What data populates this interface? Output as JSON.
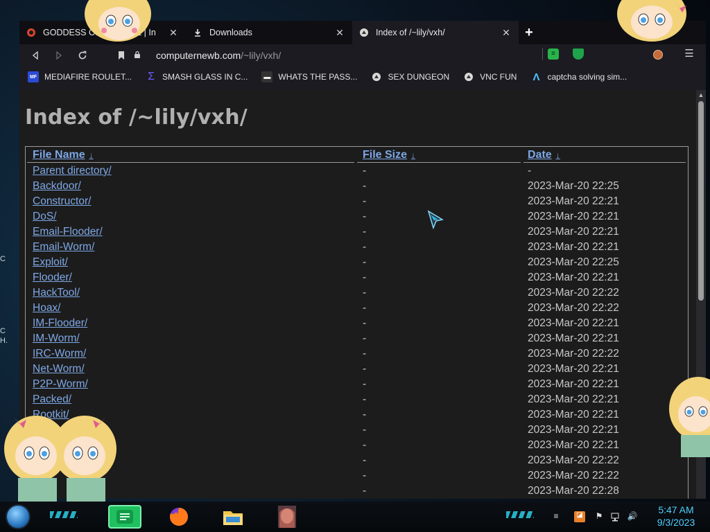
{
  "desktop": {
    "left_fragments": [
      "C",
      "C",
      "H."
    ]
  },
  "browser": {
    "tabs": [
      {
        "label": "GODDESS OF TWINKLE | In",
        "icon": "globe-icon",
        "active": false
      },
      {
        "label": "Downloads",
        "icon": "download-icon",
        "active": false
      },
      {
        "label": "Index of /~lily/vxh/",
        "icon": "site-icon",
        "active": true
      }
    ],
    "url": {
      "host": "computernewb.com",
      "path": "/~lily/vxh/"
    },
    "bookmarks": [
      {
        "label": "MEDIAFIRE ROULET...",
        "icon": "mediafire-icon"
      },
      {
        "label": "SMASH GLASS IN C...",
        "icon": "sigma-icon"
      },
      {
        "label": "WHATS THE PASS...",
        "icon": "dark-site-icon"
      },
      {
        "label": "SEX DUNGEON",
        "icon": "site-icon"
      },
      {
        "label": "VNC FUN",
        "icon": "site-icon"
      },
      {
        "label": "captcha solving sim...",
        "icon": "lambda-icon"
      }
    ]
  },
  "page": {
    "title": "Index of /~lily/vxh/",
    "columns": {
      "name": "File Name",
      "size": "File Size",
      "date": "Date",
      "sort_arrow": "↓"
    },
    "rows": [
      {
        "name": "Parent directory/",
        "size": "-",
        "date": "-"
      },
      {
        "name": "Backdoor/",
        "size": "-",
        "date": "2023-Mar-20 22:25"
      },
      {
        "name": "Constructor/",
        "size": "-",
        "date": "2023-Mar-20 22:21"
      },
      {
        "name": "DoS/",
        "size": "-",
        "date": "2023-Mar-20 22:21"
      },
      {
        "name": "Email-Flooder/",
        "size": "-",
        "date": "2023-Mar-20 22:21"
      },
      {
        "name": "Email-Worm/",
        "size": "-",
        "date": "2023-Mar-20 22:21"
      },
      {
        "name": "Exploit/",
        "size": "-",
        "date": "2023-Mar-20 22:25"
      },
      {
        "name": "Flooder/",
        "size": "-",
        "date": "2023-Mar-20 22:21"
      },
      {
        "name": "HackTool/",
        "size": "-",
        "date": "2023-Mar-20 22:22"
      },
      {
        "name": "Hoax/",
        "size": "-",
        "date": "2023-Mar-20 22:22"
      },
      {
        "name": "IM-Flooder/",
        "size": "-",
        "date": "2023-Mar-20 22:21"
      },
      {
        "name": "IM-Worm/",
        "size": "-",
        "date": "2023-Mar-20 22:21"
      },
      {
        "name": "IRC-Worm/",
        "size": "-",
        "date": "2023-Mar-20 22:22"
      },
      {
        "name": "Net-Worm/",
        "size": "-",
        "date": "2023-Mar-20 22:21"
      },
      {
        "name": "P2P-Worm/",
        "size": "-",
        "date": "2023-Mar-20 22:21"
      },
      {
        "name": "Packed/",
        "size": "-",
        "date": "2023-Mar-20 22:21"
      },
      {
        "name": "Rootkit/",
        "size": "-",
        "date": "2023-Mar-20 22:21"
      },
      {
        "name": "",
        "size": "-",
        "date": "2023-Mar-20 22:21"
      },
      {
        "name": "",
        "size": "-",
        "date": "2023-Mar-20 22:21"
      },
      {
        "name": "",
        "size": "-",
        "date": "2023-Mar-20 22:22"
      },
      {
        "name": "",
        "size": "-",
        "date": "2023-Mar-20 22:22"
      },
      {
        "name": "",
        "size": "-",
        "date": "2023-Mar-20 22:28"
      }
    ]
  },
  "taskbar": {
    "apps": [
      {
        "name": "notes-app-icon"
      },
      {
        "name": "firefox-icon"
      },
      {
        "name": "file-explorer-icon"
      },
      {
        "name": "anime-app-icon"
      }
    ],
    "time": "5:47 AM",
    "date": "9/3/2023"
  },
  "colors": {
    "link": "#7ea8e6",
    "page_bg": "#1c1c1c",
    "chrome_bg": "#1c1b22",
    "clock": "#4fd0ff"
  }
}
